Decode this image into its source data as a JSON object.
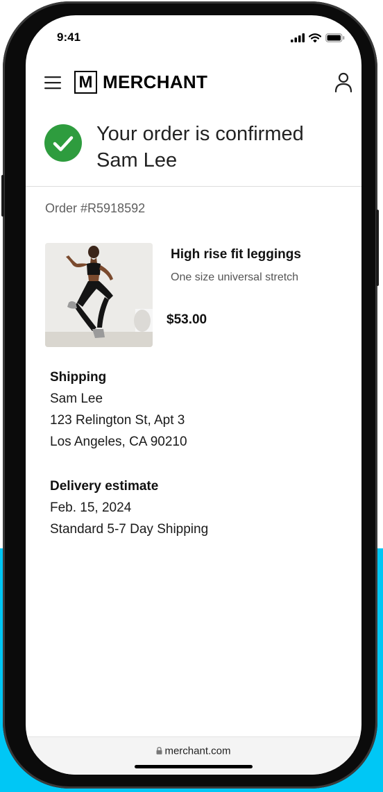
{
  "status_bar": {
    "time": "9:41"
  },
  "header": {
    "logo_mark": "M",
    "logo_text": "MERCHANT"
  },
  "confirmation": {
    "title_line1": "Your order is confirmed",
    "title_line2": "Sam Lee"
  },
  "order": {
    "number": "Order #R5918592"
  },
  "product": {
    "name": "High rise fit leggings",
    "variant": "One size universal stretch",
    "price": "$53.00"
  },
  "shipping": {
    "heading": "Shipping",
    "name": "Sam Lee",
    "address_line1": "123 Relington St, Apt 3",
    "address_line2": "Los Angeles, CA 90210"
  },
  "delivery": {
    "heading": "Delivery estimate",
    "date": "Feb. 15, 2024",
    "method": "Standard 5-7 Day Shipping"
  },
  "browser": {
    "url": "merchant.com"
  },
  "colors": {
    "accent_success": "#2e9c3e",
    "backdrop_accent": "#00c7f5",
    "text_primary": "#111111",
    "text_muted": "#5f5f5f"
  },
  "icons": [
    "menu-icon",
    "user-icon",
    "check-circle-icon",
    "lock-icon",
    "signal-icon",
    "wifi-icon",
    "battery-icon"
  ]
}
